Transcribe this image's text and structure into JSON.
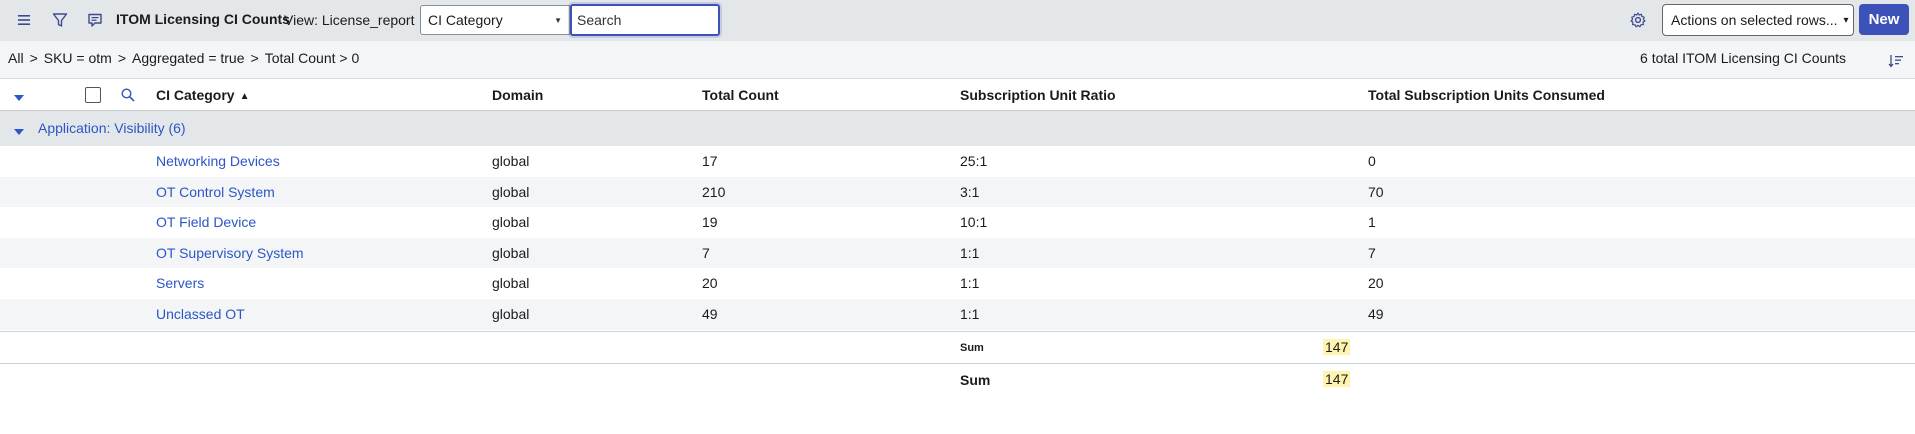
{
  "header": {
    "title": "ITOM Licensing CI Counts",
    "view_label": "View: License_report",
    "field_select_value": "CI Category",
    "search_placeholder": "Search",
    "actions_select_value": "Actions on selected rows...",
    "new_button_label": "New",
    "icons": [
      "menu-icon",
      "filter-icon",
      "context-menu-icon",
      "settings-icon"
    ]
  },
  "breadcrumb": {
    "items": [
      "All",
      "SKU = otm",
      "Aggregated = true",
      "Total Count > 0"
    ],
    "separator": ">"
  },
  "total_count_text": "6 total ITOM Licensing CI Counts",
  "columns": [
    "CI Category",
    "Domain",
    "Total Count",
    "Subscription Unit Ratio",
    "Total Subscription Units Consumed"
  ],
  "group": {
    "label": "Application: Visibility (6)"
  },
  "rows": [
    {
      "ci_category": "Networking Devices",
      "domain": "global",
      "total_count": "17",
      "ratio": "25:1",
      "consumed": "0"
    },
    {
      "ci_category": "OT Control System",
      "domain": "global",
      "total_count": "210",
      "ratio": "3:1",
      "consumed": "70"
    },
    {
      "ci_category": "OT Field Device",
      "domain": "global",
      "total_count": "19",
      "ratio": "10:1",
      "consumed": "1"
    },
    {
      "ci_category": "OT Supervisory System",
      "domain": "global",
      "total_count": "7",
      "ratio": "1:1",
      "consumed": "7"
    },
    {
      "ci_category": "Servers",
      "domain": "global",
      "total_count": "20",
      "ratio": "1:1",
      "consumed": "20"
    },
    {
      "ci_category": "Unclassed OT",
      "domain": "global",
      "total_count": "49",
      "ratio": "1:1",
      "consumed": "49"
    }
  ],
  "sums": [
    {
      "label": "Sum",
      "value": "147"
    },
    {
      "label": "Sum",
      "value": "147"
    }
  ],
  "colors": {
    "accent": "#3d52b8",
    "link": "#2b56c4",
    "header_bg": "#e4e7ea",
    "sum_highlight": "#fff3b0"
  }
}
